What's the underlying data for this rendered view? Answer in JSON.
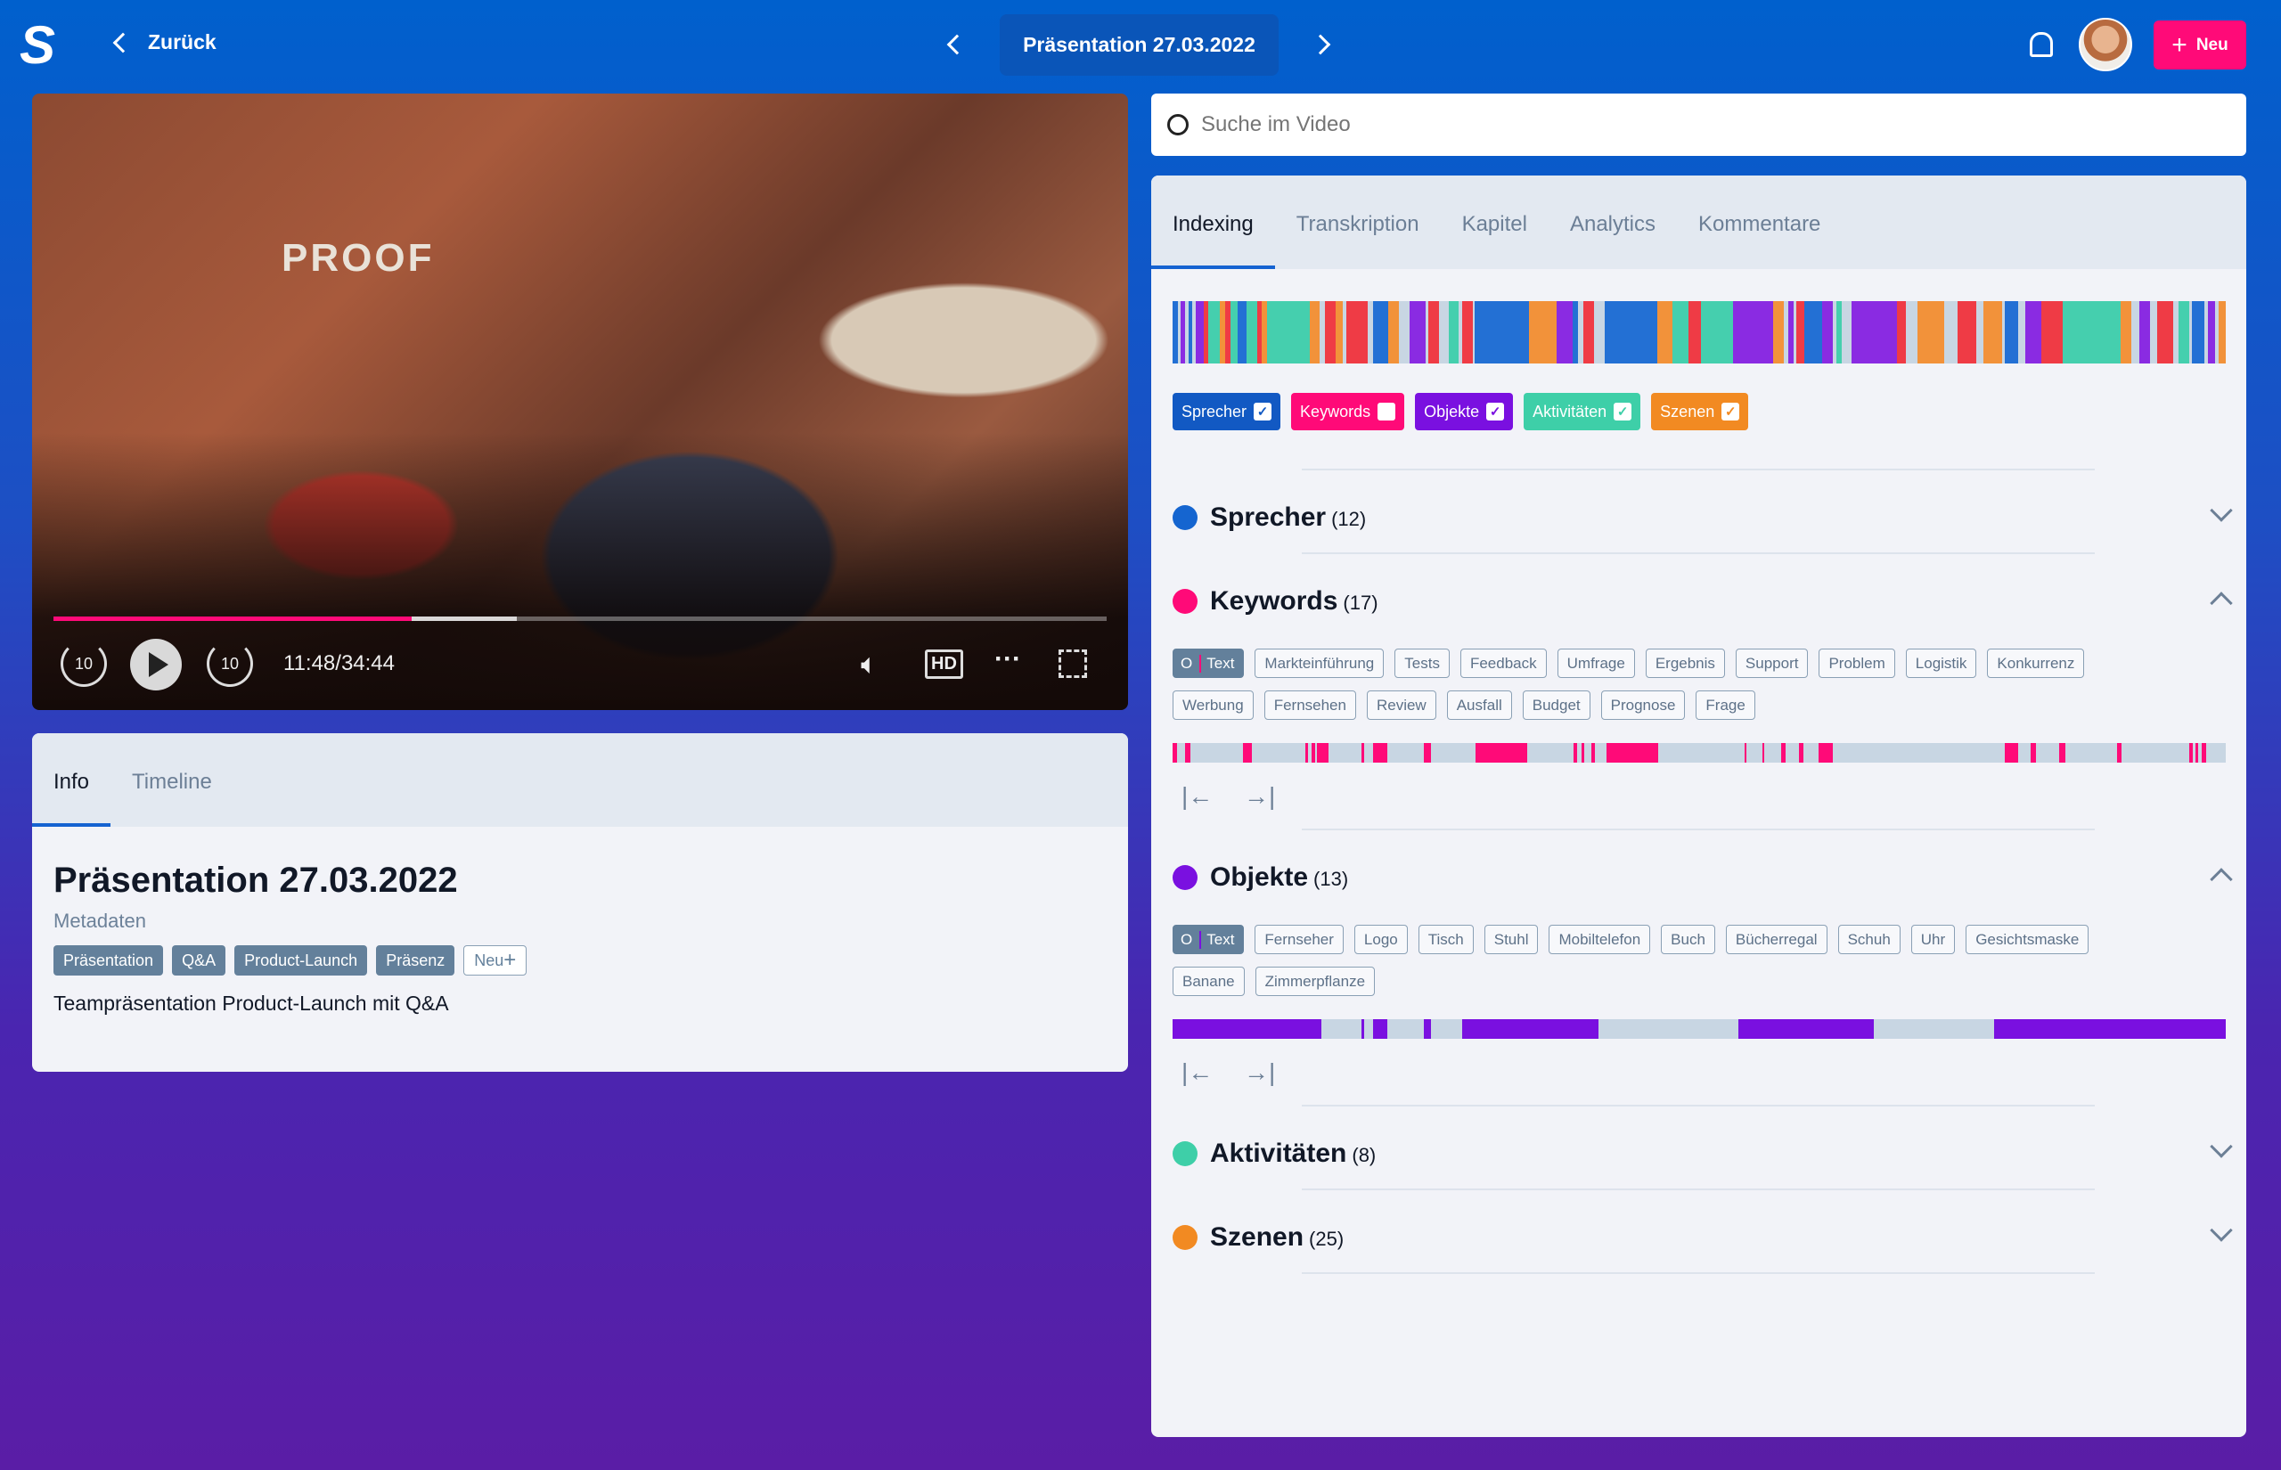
{
  "header": {
    "logo": "S",
    "back_label": "Zurück",
    "title": "Präsentation 27.03.2022",
    "new_label": "Neu",
    "icons": {
      "back": "chevron-left-icon",
      "prev": "chevron-left-icon",
      "next": "chevron-right-icon",
      "bell": "bell-icon",
      "plus": "plus-icon"
    }
  },
  "player": {
    "time": "11:48/34:44",
    "progress": 0.34,
    "buffered": 0.44,
    "rewind_label": "10",
    "forward_label": "10",
    "hd_label": "HD",
    "more_label": "···",
    "watermark": "PROOF"
  },
  "info": {
    "tabs": [
      "Info",
      "Timeline"
    ],
    "active_tab": "Info",
    "title": "Präsentation 27.03.2022",
    "subtitle": "Metadaten",
    "tags": [
      "Präsentation",
      "Q&A",
      "Product-Launch",
      "Präsenz"
    ],
    "new_tag_label": "Neu",
    "description": "Teampräsentation Product-Launch mit Q&A"
  },
  "search": {
    "placeholder": "Suche im Video"
  },
  "indexing": {
    "tabs": [
      "Indexing",
      "Transkription",
      "Kapitel",
      "Analytics",
      "Kommentare"
    ],
    "active_tab": "Indexing",
    "colors": {
      "speaker": "#2370d4",
      "keyword": "#ef3b45",
      "object": "#8a2be2",
      "activity": "#45cfae",
      "scene": "#f2923a",
      "empty": "#c8d6e3"
    },
    "overview": [
      [
        0,
        0.005,
        "speaker"
      ],
      [
        0.008,
        0.012,
        "object"
      ],
      [
        0.015,
        0.019,
        "speaker"
      ],
      [
        0.022,
        0.03,
        "object"
      ],
      [
        0.03,
        0.034,
        "keyword"
      ],
      [
        0.034,
        0.045,
        "activity"
      ],
      [
        0.045,
        0.05,
        "scene"
      ],
      [
        0.05,
        0.055,
        "keyword"
      ],
      [
        0.055,
        0.062,
        "activity"
      ],
      [
        0.062,
        0.07,
        "speaker"
      ],
      [
        0.07,
        0.08,
        "activity"
      ],
      [
        0.08,
        0.085,
        "keyword"
      ],
      [
        0.085,
        0.09,
        "scene"
      ],
      [
        0.09,
        0.13,
        "activity"
      ],
      [
        0.13,
        0.14,
        "scene"
      ],
      [
        0.145,
        0.155,
        "keyword"
      ],
      [
        0.155,
        0.162,
        "scene"
      ],
      [
        0.165,
        0.185,
        "keyword"
      ],
      [
        0.19,
        0.205,
        "speaker"
      ],
      [
        0.205,
        0.215,
        "scene"
      ],
      [
        0.225,
        0.24,
        "object"
      ],
      [
        0.243,
        0.253,
        "keyword"
      ],
      [
        0.262,
        0.272,
        "activity"
      ],
      [
        0.275,
        0.285,
        "keyword"
      ],
      [
        0.287,
        0.338,
        "speaker"
      ],
      [
        0.338,
        0.365,
        "scene"
      ],
      [
        0.365,
        0.38,
        "object"
      ],
      [
        0.38,
        0.385,
        "speaker"
      ],
      [
        0.39,
        0.4,
        "keyword"
      ],
      [
        0.41,
        0.46,
        "speaker"
      ],
      [
        0.46,
        0.475,
        "scene"
      ],
      [
        0.475,
        0.49,
        "activity"
      ],
      [
        0.49,
        0.502,
        "keyword"
      ],
      [
        0.502,
        0.532,
        "activity"
      ],
      [
        0.532,
        0.57,
        "object"
      ],
      [
        0.57,
        0.58,
        "scene"
      ],
      [
        0.585,
        0.59,
        "object"
      ],
      [
        0.592,
        0.6,
        "keyword"
      ],
      [
        0.6,
        0.617,
        "speaker"
      ],
      [
        0.617,
        0.627,
        "object"
      ],
      [
        0.63,
        0.635,
        "activity"
      ],
      [
        0.645,
        0.688,
        "object"
      ],
      [
        0.688,
        0.696,
        "keyword"
      ],
      [
        0.707,
        0.733,
        "scene"
      ],
      [
        0.745,
        0.763,
        "keyword"
      ],
      [
        0.77,
        0.788,
        "scene"
      ],
      [
        0.79,
        0.803,
        "speaker"
      ],
      [
        0.81,
        0.825,
        "object"
      ],
      [
        0.825,
        0.845,
        "keyword"
      ],
      [
        0.845,
        0.9,
        "activity"
      ],
      [
        0.9,
        0.91,
        "scene"
      ],
      [
        0.918,
        0.928,
        "object"
      ],
      [
        0.935,
        0.95,
        "keyword"
      ],
      [
        0.955,
        0.965,
        "activity"
      ],
      [
        0.968,
        0.98,
        "speaker"
      ],
      [
        0.983,
        0.99,
        "object"
      ],
      [
        0.993,
        1.0,
        "scene"
      ]
    ],
    "filters": [
      {
        "label": "Sprecher",
        "color": "#1259c3",
        "checked": true
      },
      {
        "label": "Keywords",
        "color": "#ff0a78",
        "checked": false
      },
      {
        "label": "Objekte",
        "color": "#7a10e0",
        "checked": true
      },
      {
        "label": "Aktivitäten",
        "color": "#3ecfa8",
        "checked": true
      },
      {
        "label": "Szenen",
        "color": "#f28a22",
        "checked": true
      }
    ],
    "sections": [
      {
        "title": "Sprecher",
        "count": "(12)",
        "color": "#1565d0",
        "expanded": false
      },
      {
        "title": "Keywords",
        "count": "(17)",
        "color": "#ff0a78",
        "expanded": true,
        "text_tag": "Text",
        "tags": [
          "Markteinführung",
          "Tests",
          "Feedback",
          "Umfrage",
          "Ergebnis",
          "Support",
          "Problem",
          "Logistik",
          "Konkurrenz",
          "Werbung",
          "Fernsehen",
          "Review",
          "Ausfall",
          "Budget",
          "Prognose",
          "Frage"
        ],
        "timeline": [
          [
            0,
            0.004
          ],
          [
            0.012,
            0.017
          ],
          [
            0.067,
            0.075
          ],
          [
            0.126,
            0.129
          ],
          [
            0.132,
            0.135
          ],
          [
            0.137,
            0.148
          ],
          [
            0.179,
            0.182
          ],
          [
            0.19,
            0.204
          ],
          [
            0.239,
            0.245
          ],
          [
            0.288,
            0.337
          ],
          [
            0.381,
            0.384
          ],
          [
            0.388,
            0.391
          ],
          [
            0.398,
            0.401
          ],
          [
            0.412,
            0.461
          ],
          [
            0.543,
            0.545
          ],
          [
            0.56,
            0.562
          ],
          [
            0.578,
            0.582
          ],
          [
            0.595,
            0.599
          ],
          [
            0.613,
            0.627
          ],
          [
            0.79,
            0.803
          ],
          [
            0.815,
            0.82
          ],
          [
            0.842,
            0.848
          ],
          [
            0.897,
            0.901
          ],
          [
            0.965,
            0.969
          ],
          [
            0.971,
            0.974
          ],
          [
            0.977,
            0.981
          ]
        ]
      },
      {
        "title": "Objekte",
        "count": "(13)",
        "color": "#7a10e0",
        "expanded": true,
        "text_tag": "Text",
        "tags": [
          "Fernseher",
          "Logo",
          "Tisch",
          "Stuhl",
          "Mobiltelefon",
          "Buch",
          "Bücherregal",
          "Schuh",
          "Uhr",
          "Gesichtsmaske",
          "Banane",
          "Zimmerpflanze"
        ],
        "timeline": [
          [
            0,
            0.141
          ],
          [
            0.179,
            0.182
          ],
          [
            0.19,
            0.204
          ],
          [
            0.239,
            0.245
          ],
          [
            0.275,
            0.404
          ],
          [
            0.537,
            0.666
          ],
          [
            0.78,
            1.0
          ]
        ]
      },
      {
        "title": "Aktivitäten",
        "count": "(8)",
        "color": "#3ecfa8",
        "expanded": false
      },
      {
        "title": "Szenen",
        "count": "(25)",
        "color": "#f28a22",
        "expanded": false
      }
    ]
  }
}
